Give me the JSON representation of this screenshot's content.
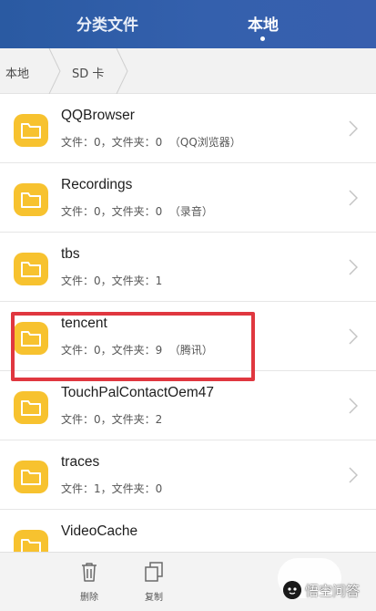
{
  "header": {
    "tabs": [
      {
        "label": "分类文件",
        "active": false
      },
      {
        "label": "本地",
        "active": true
      }
    ]
  },
  "breadcrumb": {
    "items": [
      "本地",
      "SD 卡"
    ]
  },
  "files": [
    {
      "name": "QQBrowser",
      "meta": "文件：0，文件夹：0  （QQ浏览器）"
    },
    {
      "name": "Recordings",
      "meta": "文件：0，文件夹：0  （录音）"
    },
    {
      "name": "tbs",
      "meta": "文件：0，文件夹：1"
    },
    {
      "name": "tencent",
      "meta": "文件：0，文件夹：9  （腾讯）",
      "highlighted": true
    },
    {
      "name": "TouchPalContactOem47",
      "meta": "文件：0，文件夹：2"
    },
    {
      "name": "traces",
      "meta": "文件：1，文件夹：0"
    },
    {
      "name": "VideoCache",
      "meta": ""
    }
  ],
  "actions": [
    {
      "label": "删除",
      "icon": "trash-icon"
    },
    {
      "label": "复制",
      "icon": "copy-icon"
    }
  ],
  "watermark": {
    "text": "悟空问答"
  },
  "colors": {
    "header": "#3460ad",
    "folder": "#f7c22f",
    "highlight": "#e0373f"
  }
}
